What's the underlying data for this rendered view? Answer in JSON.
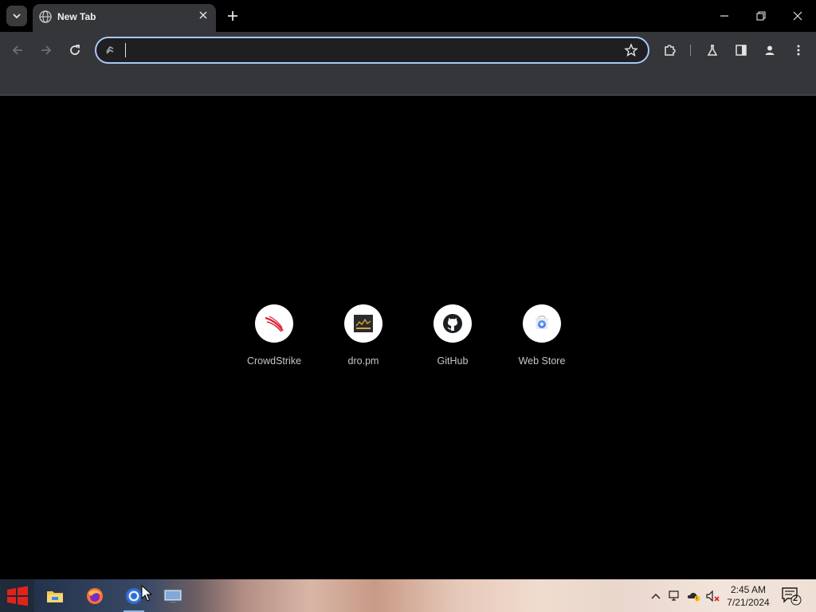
{
  "window": {
    "tab_title": "New Tab",
    "tab_favicon": "globe-icon",
    "controls": [
      "minimize-icon",
      "restore-icon",
      "close-icon"
    ]
  },
  "toolbar": {
    "back": "back-arrow-icon",
    "forward": "forward-arrow-icon",
    "reload": "reload-icon",
    "address_value": "",
    "address_placeholder": "",
    "right_icons": [
      "bookmark-star-icon",
      "extensions-icon",
      "labs-flask-icon",
      "side-panel-icon",
      "profile-icon",
      "menu-icon"
    ]
  },
  "shortcuts": [
    {
      "label": "CrowdStrike",
      "icon": "crowdstrike-icon"
    },
    {
      "label": "dro.pm",
      "icon": "dropm-icon"
    },
    {
      "label": "GitHub",
      "icon": "github-icon"
    },
    {
      "label": "Web Store",
      "icon": "web-store-icon"
    }
  ],
  "taskbar": {
    "apps": [
      "file-explorer-icon",
      "firefox-icon",
      "chrome-icon",
      "remote-desktop-icon"
    ],
    "tray_icons": [
      "show-hidden-icons-chevron",
      "network-icon",
      "onedrive-warning-icon",
      "volume-muted-icon"
    ],
    "time": "2:45 AM",
    "date": "7/21/2024",
    "notification_count": "2"
  },
  "colors": {
    "accent_focus": "#a8c7fa",
    "toolbar_bg": "#35363a",
    "page_bg": "#000000",
    "crowdstrike_red": "#e01e37"
  }
}
